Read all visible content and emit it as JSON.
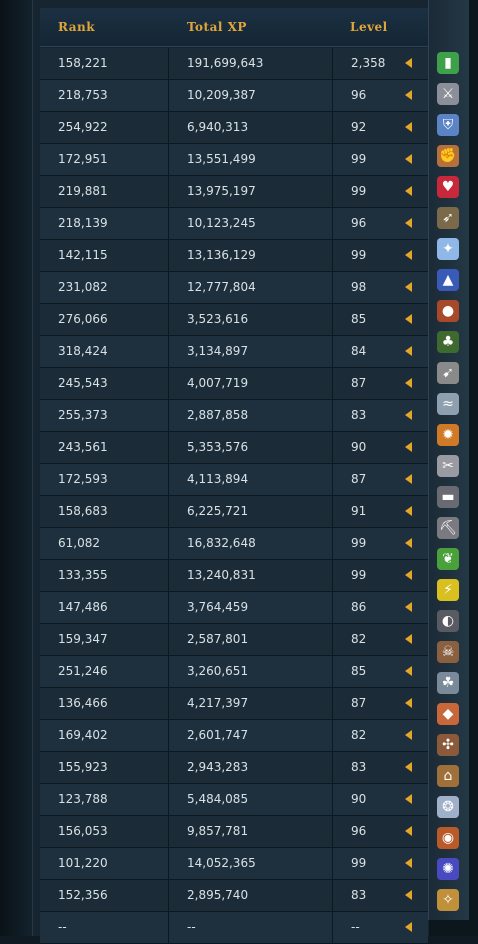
{
  "header": {
    "rank": "Rank",
    "total_xp": "Total XP",
    "level": "Level"
  },
  "rows": [
    {
      "rank": "158,221",
      "xp": "191,699,643",
      "level": "2,358",
      "icon": "overall-icon"
    },
    {
      "rank": "218,753",
      "xp": "10,209,387",
      "level": "96",
      "icon": "attack-icon"
    },
    {
      "rank": "254,922",
      "xp": "6,940,313",
      "level": "92",
      "icon": "defence-icon"
    },
    {
      "rank": "172,951",
      "xp": "13,551,499",
      "level": "99",
      "icon": "strength-icon"
    },
    {
      "rank": "219,881",
      "xp": "13,975,197",
      "level": "99",
      "icon": "constitution-icon"
    },
    {
      "rank": "218,139",
      "xp": "10,123,245",
      "level": "96",
      "icon": "ranged-icon"
    },
    {
      "rank": "142,115",
      "xp": "13,136,129",
      "level": "99",
      "icon": "prayer-icon"
    },
    {
      "rank": "231,082",
      "xp": "12,777,804",
      "level": "98",
      "icon": "magic-icon"
    },
    {
      "rank": "276,066",
      "xp": "3,523,616",
      "level": "85",
      "icon": "cooking-icon"
    },
    {
      "rank": "318,424",
      "xp": "3,134,897",
      "level": "84",
      "icon": "woodcutting-icon"
    },
    {
      "rank": "245,543",
      "xp": "4,007,719",
      "level": "87",
      "icon": "fletching-icon"
    },
    {
      "rank": "255,373",
      "xp": "2,887,858",
      "level": "83",
      "icon": "fishing-icon"
    },
    {
      "rank": "243,561",
      "xp": "5,353,576",
      "level": "90",
      "icon": "firemaking-icon"
    },
    {
      "rank": "172,593",
      "xp": "4,113,894",
      "level": "87",
      "icon": "crafting-icon"
    },
    {
      "rank": "158,683",
      "xp": "6,225,721",
      "level": "91",
      "icon": "smithing-icon"
    },
    {
      "rank": "61,082",
      "xp": "16,832,648",
      "level": "99",
      "icon": "mining-icon"
    },
    {
      "rank": "133,355",
      "xp": "13,240,831",
      "level": "99",
      "icon": "herblore-icon"
    },
    {
      "rank": "147,486",
      "xp": "3,764,459",
      "level": "86",
      "icon": "agility-icon"
    },
    {
      "rank": "159,347",
      "xp": "2,587,801",
      "level": "82",
      "icon": "thieving-icon"
    },
    {
      "rank": "251,246",
      "xp": "3,260,651",
      "level": "85",
      "icon": "slayer-icon"
    },
    {
      "rank": "136,466",
      "xp": "4,217,397",
      "level": "87",
      "icon": "farming-icon"
    },
    {
      "rank": "169,402",
      "xp": "2,601,747",
      "level": "82",
      "icon": "runecrafting-icon"
    },
    {
      "rank": "155,923",
      "xp": "2,943,283",
      "level": "83",
      "icon": "hunter-icon"
    },
    {
      "rank": "123,788",
      "xp": "5,484,085",
      "level": "90",
      "icon": "construction-icon"
    },
    {
      "rank": "156,053",
      "xp": "9,857,781",
      "level": "96",
      "icon": "summoning-icon"
    },
    {
      "rank": "101,220",
      "xp": "14,052,365",
      "level": "99",
      "icon": "dungeoneering-icon"
    },
    {
      "rank": "152,356",
      "xp": "2,895,740",
      "level": "83",
      "icon": "divination-icon"
    },
    {
      "rank": "--",
      "xp": "--",
      "level": "--",
      "icon": "invention-icon"
    }
  ],
  "icon_glyphs": {
    "overall-icon": "▮",
    "attack-icon": "⚔",
    "defence-icon": "⛨",
    "strength-icon": "✊",
    "constitution-icon": "♥",
    "ranged-icon": "➶",
    "prayer-icon": "✦",
    "magic-icon": "▲",
    "cooking-icon": "●",
    "woodcutting-icon": "♣",
    "fletching-icon": "➹",
    "fishing-icon": "≈",
    "firemaking-icon": "✹",
    "crafting-icon": "✂",
    "smithing-icon": "▬",
    "mining-icon": "⛏",
    "herblore-icon": "❦",
    "agility-icon": "⚡",
    "thieving-icon": "◐",
    "slayer-icon": "☠",
    "farming-icon": "☘",
    "runecrafting-icon": "◆",
    "hunter-icon": "✣",
    "construction-icon": "⌂",
    "summoning-icon": "❂",
    "dungeoneering-icon": "◉",
    "divination-icon": "✺",
    "invention-icon": "✧"
  },
  "icon_colors": {
    "overall-icon": "#3fa04a",
    "attack-icon": "#8b8f99",
    "defence-icon": "#5a84c6",
    "strength-icon": "#b5703c",
    "constitution-icon": "#c8283a",
    "ranged-icon": "#7a6a4a",
    "prayer-icon": "#8fb8e8",
    "magic-icon": "#3a5ab8",
    "cooking-icon": "#a84a2a",
    "woodcutting-icon": "#3f6a2f",
    "fletching-icon": "#8a8a8a",
    "fishing-icon": "#8ea0b0",
    "firemaking-icon": "#d07a28",
    "crafting-icon": "#9a9aa2",
    "smithing-icon": "#6a6a72",
    "mining-icon": "#7a7a80",
    "herblore-icon": "#4aa03a",
    "agility-icon": "#d8c020",
    "thieving-icon": "#5a5a62",
    "slayer-icon": "#8a6040",
    "farming-icon": "#7a8a9a",
    "runecrafting-icon": "#c8683a",
    "hunter-icon": "#8a5a3a",
    "construction-icon": "#a0703a",
    "summoning-icon": "#a0b0c8",
    "dungeoneering-icon": "#b85a2a",
    "divination-icon": "#4a4ac0",
    "invention-icon": "#c0903a"
  },
  "arrow_color": "#e3a629",
  "accent_color": "#e0a53b"
}
